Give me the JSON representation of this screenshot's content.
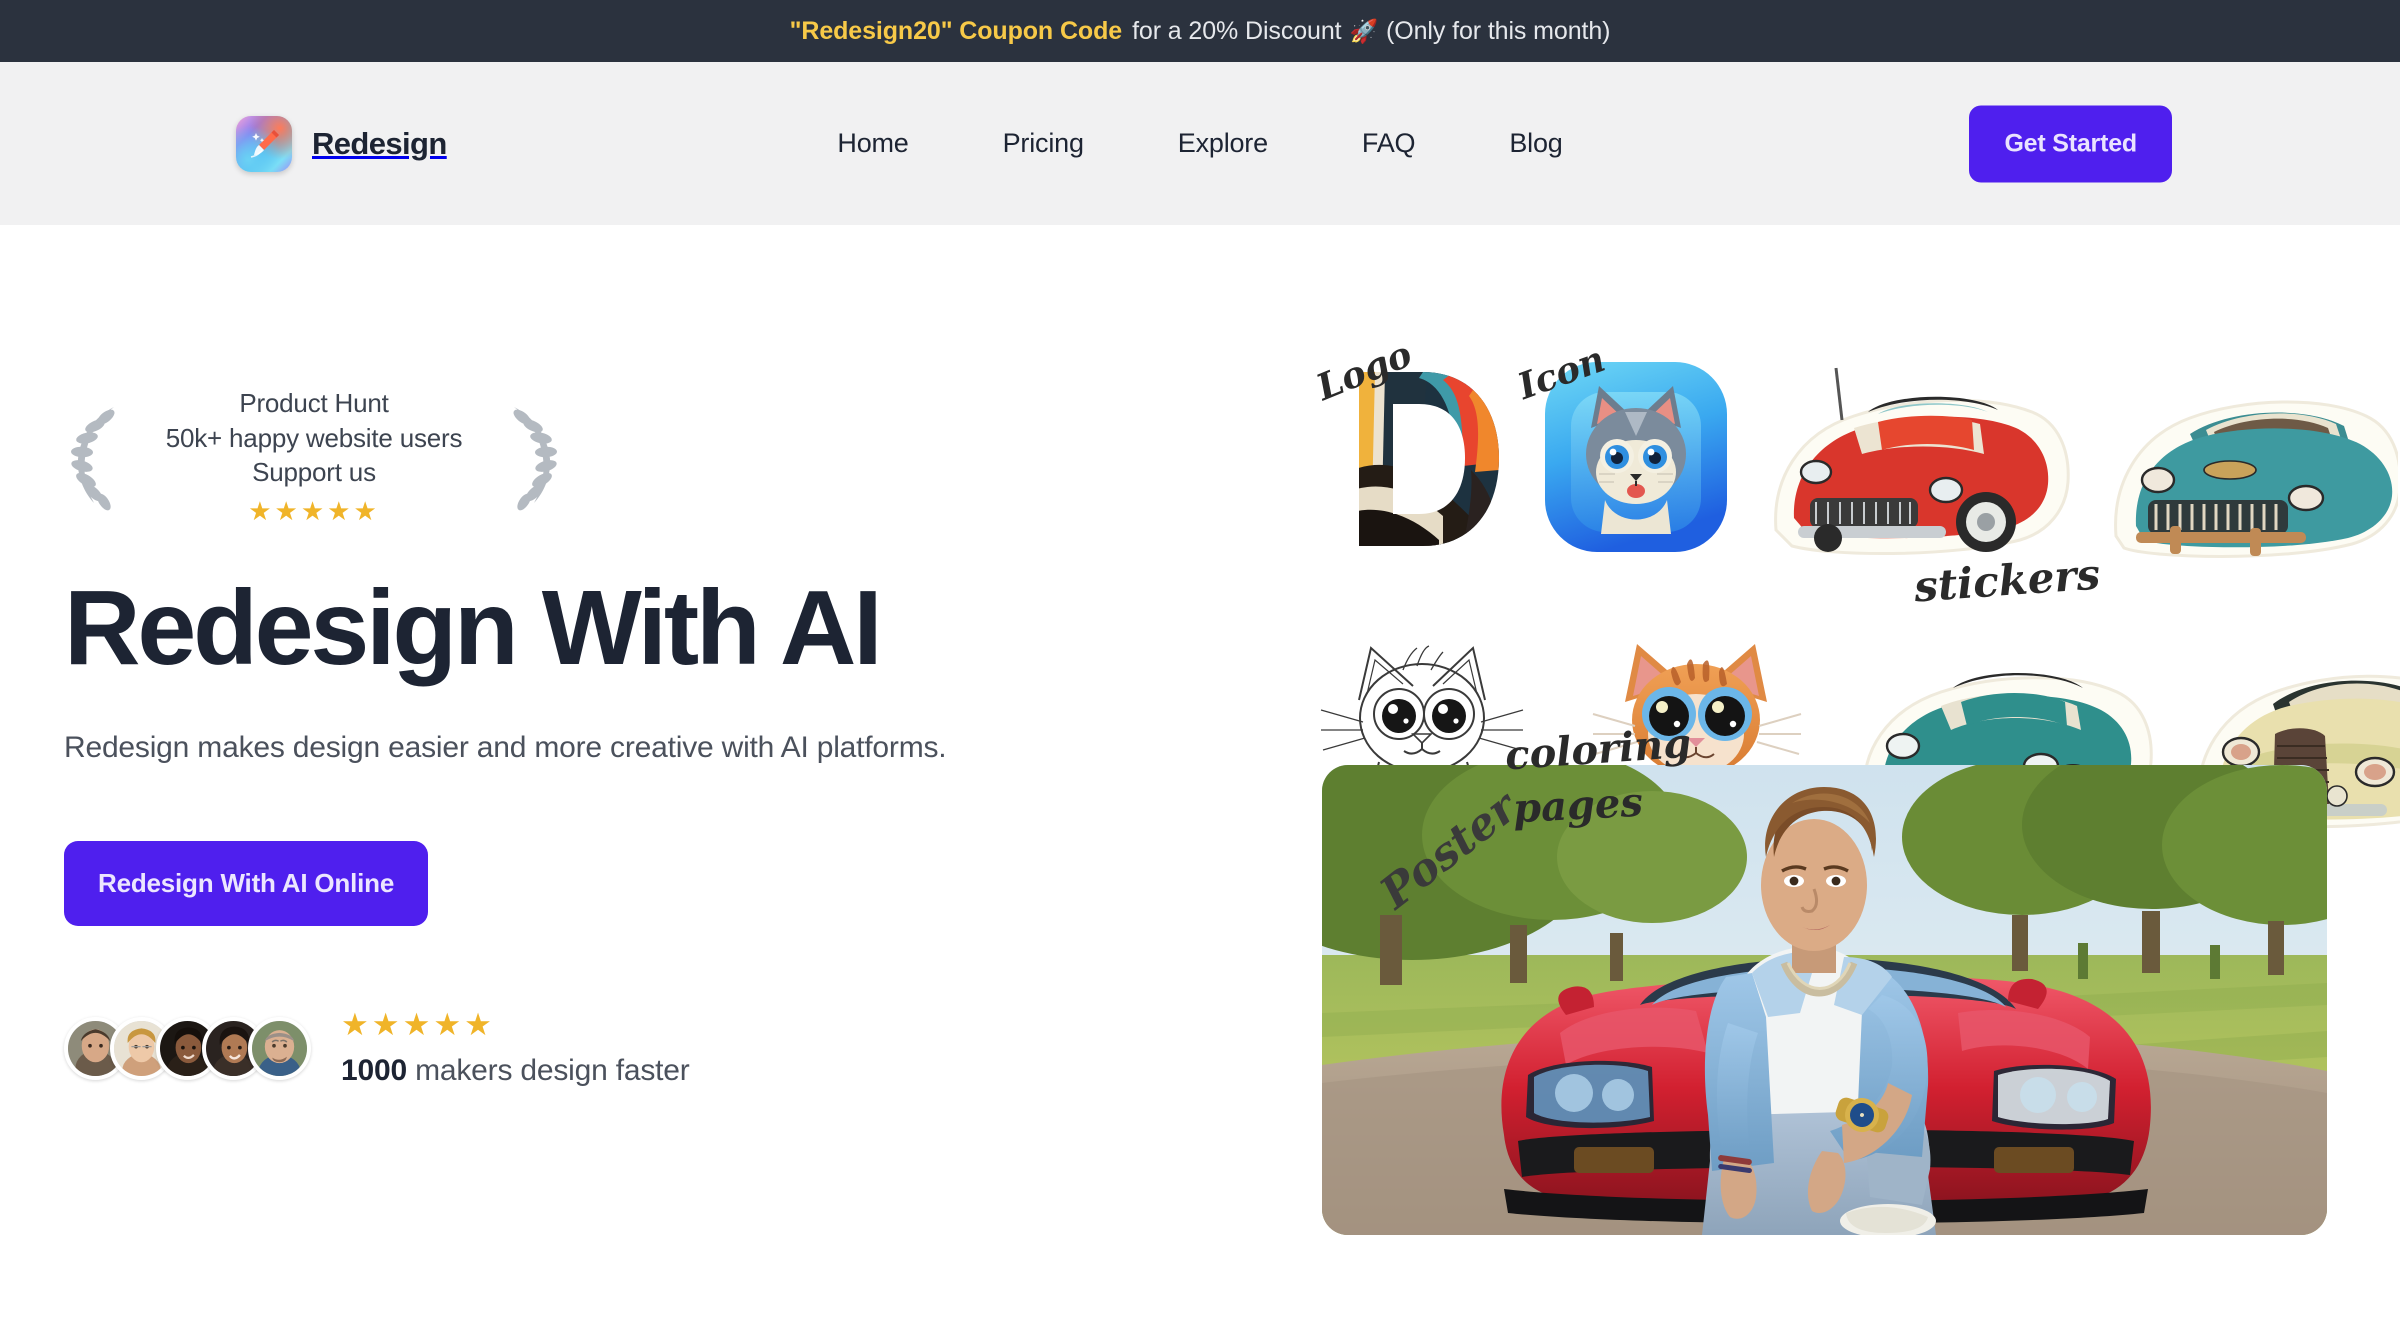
{
  "banner": {
    "coupon_text": "\"Redesign20\" Coupon Code",
    "rest_text": "for a 20% Discount",
    "rocket_icon": "🚀",
    "note_text": "(Only for this month)",
    "bg_color": "#2b323e",
    "coupon_color": "#f7c948"
  },
  "header": {
    "brand_name": "Redesign",
    "logo_icon": "paintbrush-app-icon",
    "bg_color": "#f1f1f2",
    "nav": [
      {
        "label": "Home"
      },
      {
        "label": "Pricing"
      },
      {
        "label": "Explore"
      },
      {
        "label": "FAQ"
      },
      {
        "label": "Blog"
      }
    ],
    "cta_label": "Get Started",
    "cta_color": "#4f1fee"
  },
  "hero": {
    "badge": {
      "line1": "Product Hunt",
      "line2": "50k+ happy website users",
      "line3": "Support us",
      "stars": "★★★★★",
      "star_color": "#f0b429",
      "laurel_icon": "laurel-wreath-icon"
    },
    "headline": "Redesign With AI",
    "subhead": "Redesign makes design easier and more creative with AI platforms.",
    "cta_label": "Redesign With AI Online",
    "cta_color": "#4f1fee",
    "social": {
      "stars": "★★★★★",
      "count": "1000",
      "caption": "makers design faster",
      "avatar_count": 5
    }
  },
  "gallery": {
    "tiles": [
      {
        "tag": "Logo",
        "name": "logo-sample-letter-d"
      },
      {
        "tag": "Icon",
        "name": "icon-sample-cat-app-icon"
      },
      {
        "tag": "stickers",
        "name": "stickers-sample-classic-cars"
      },
      {
        "tag": "coloring",
        "name": "coloring-sample-sketch-cat"
      },
      {
        "tag": "pages",
        "name": "coloring-sample-color-cat"
      },
      {
        "tag": "Poster",
        "name": "poster-sample-man-red-car"
      }
    ]
  }
}
